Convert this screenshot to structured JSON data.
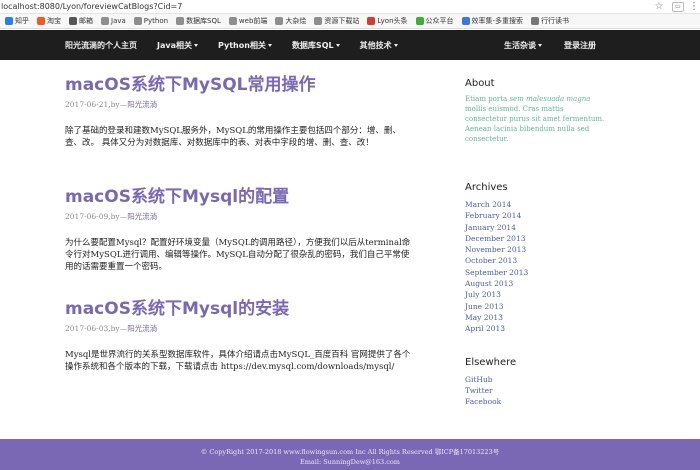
{
  "browser": {
    "url": "localhost:8080/Lyon/foreviewCatBlogs?Cid=7",
    "bookmarks": [
      {
        "label": "知乎",
        "icon": "zhihu-icon",
        "color": "#2b7de9"
      },
      {
        "label": "淘宝",
        "icon": "taobao-icon",
        "color": "#f25a20"
      },
      {
        "label": "邮箱",
        "icon": "mail-icon",
        "color": "#555555"
      },
      {
        "label": "Java",
        "icon": "folder-icon",
        "color": "#8e8e8e"
      },
      {
        "label": "Python",
        "icon": "folder-icon",
        "color": "#8e8e8e"
      },
      {
        "label": "数据库SQL",
        "icon": "folder-icon",
        "color": "#8e8e8e"
      },
      {
        "label": "web前端",
        "icon": "folder-icon",
        "color": "#8e8e8e"
      },
      {
        "label": "大杂烩",
        "icon": "folder-icon",
        "color": "#8e8e8e"
      },
      {
        "label": "资源下载站",
        "icon": "folder-icon",
        "color": "#8e8e8e"
      },
      {
        "label": "Lyon头条",
        "icon": "toutiao-icon",
        "color": "#d43b33"
      },
      {
        "label": "公众平台",
        "icon": "wechat-icon",
        "color": "#3cb034"
      },
      {
        "label": "效率集-多重搜索",
        "icon": "search-icon",
        "color": "#3a79d8"
      },
      {
        "label": "行行读书",
        "icon": "book-icon",
        "color": "#777777"
      }
    ]
  },
  "nav": {
    "brand": "阳光流淌的个人主页",
    "items": [
      "Java相关",
      "Python相关",
      "数据库SQL",
      "其他技术"
    ],
    "life": "生活杂谈",
    "login": "登录注册"
  },
  "posts": [
    {
      "title": "macOS系统下MySQL常用操作",
      "date": "2017-06-21",
      "by": ",by—",
      "author": "阳光流淌",
      "body": "除了基础的登录和建数MySQL服务外，MySQL的常用操作主要包括四个部分：增、删、查、改。 具体又分为对数据库、对数据库中的表、对表中字段的增、删、查、改！"
    },
    {
      "title": "macOS系统下Mysql的配置",
      "date": "2017-06-09",
      "by": ",by—",
      "author": "阳光流淌",
      "body": "为什么要配置Mysql？配置好环境变量（MySQL的调用路径），方便我们以后从terminal命令行对MySQL进行调用、编辑等操作。MySQL自动分配了很杂乱的密码，我们自己平常使用的话需要重置一个密码。"
    },
    {
      "title": "macOS系统下Mysql的安装",
      "date": "2017-06-03",
      "by": ",by—",
      "author": "阳光流淌",
      "body": "Mysql是世界流行的关系型数据库软件，具体介绍请点击MySQL_百度百科 官网提供了各个操作系统和各个版本的下载，下载请点击 https://dev.mysql.com/downloads/mysql/"
    }
  ],
  "sidebar": {
    "about_title": "About",
    "about_text_1": "Etiam porta ",
    "about_text_em": "sem malesuada magna",
    "about_text_2": " mollis euismod. Cras mattis consectetur purus sit amet fermentum. Aenean lacinia bibendum nulla sed consectetur.",
    "archives_title": "Archives",
    "archives": [
      "March 2014",
      "February 2014",
      "January 2014",
      "December 2013",
      "November 2013",
      "October 2013",
      "September 2013",
      "August 2013",
      "July 2013",
      "June 2013",
      "May 2013",
      "April 2013"
    ],
    "elsewhere_title": "Elsewhere",
    "elsewhere": [
      "GitHub",
      "Twitter",
      "Facebook"
    ]
  },
  "footer": {
    "line1": "© CopyRight 2017-2018 www.flowingsun.com Inc All Rights Reserved 鄂ICP备17013223号",
    "line2": "Email: SunningDew@163.com"
  },
  "colors": {
    "accent": "#7b68b5",
    "navbar": "#1e1e1e",
    "link": "#4a5fa8",
    "about": "#5fb895"
  }
}
